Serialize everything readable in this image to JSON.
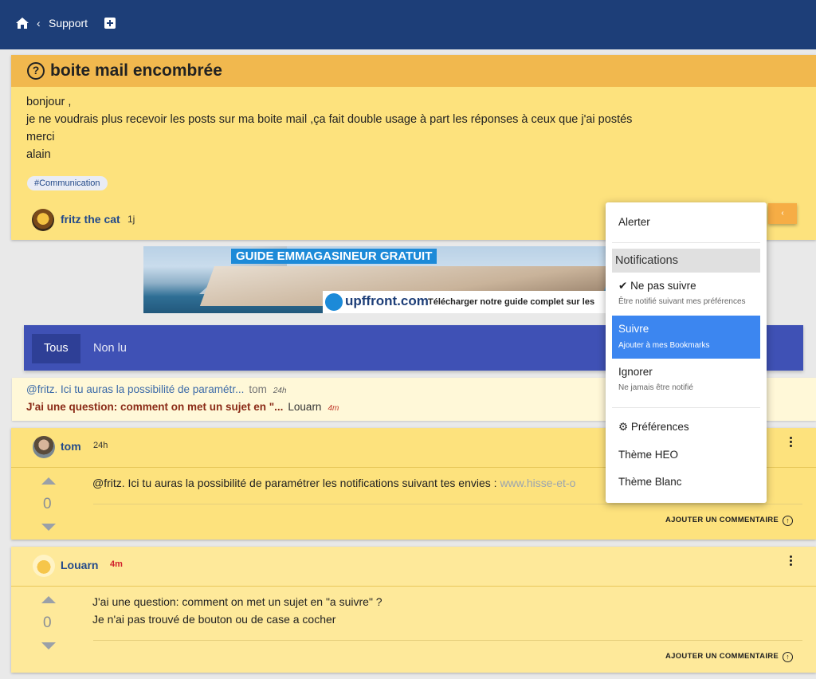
{
  "topbar": {
    "home_icon": "home-icon",
    "back_label": "Support",
    "add_icon": "plus-square-icon",
    "color": "#1d3e78"
  },
  "question": {
    "title": "boite mail encombrée",
    "body": [
      "bonjour ,",
      "je ne voudrais plus recevoir les posts sur ma boite mail ,ça fait double usage à part les réponses à ceux que j'ai postés",
      "merci",
      "alain"
    ],
    "tag": "#Communication",
    "author": "fritz the cat",
    "time": "1j",
    "header_color": "#f1b84e",
    "body_color": "#fde27d"
  },
  "banner": {
    "title": "GUIDE EMMAGASINEUR GRATUIT",
    "logo": "upffront.com",
    "tagline": "Télécharger notre guide complet sur les"
  },
  "tabs": {
    "items": [
      "Tous",
      "Non lu"
    ],
    "active": "Tous"
  },
  "notifications": [
    {
      "text": "@fritz. Ici tu auras la possibilité de paramétr...",
      "author": "tom",
      "time": "24h"
    },
    {
      "text": "J'ai une question: comment on met un sujet en \"...",
      "author": "Louarn",
      "time": "4m"
    }
  ],
  "posts": [
    {
      "author": "tom",
      "time": "24h",
      "votes": "0",
      "lines": [
        "@fritz. Ici tu auras la possibilité de paramétrer les notifications suivant tes envies : "
      ],
      "link": "www.hisse-et-o",
      "comment_label": "AJOUTER UN COMMENTAIRE"
    },
    {
      "author": "Louarn",
      "time": "4m",
      "votes": "0",
      "lines": [
        "J'ai une question: comment on met un sujet en \"a suivre\" ?",
        "Je n'ai pas trouvé de bouton ou de case a cocher"
      ],
      "comment_label": "AJOUTER UN COMMENTAIRE"
    }
  ],
  "dropdown": {
    "alert": "Alerter",
    "section": "Notifications",
    "options": [
      {
        "label": "Ne pas suivre",
        "sub": "Être notifié suivant mes préférences",
        "icon": "check-icon"
      },
      {
        "label": "Suivre",
        "sub": "Ajouter à mes Bookmarks",
        "selected": true
      },
      {
        "label": "Ignorer",
        "sub": "Ne jamais être notifié"
      }
    ],
    "preferences": "Préférences",
    "themes": [
      "Thème HEO",
      "Thème Blanc"
    ],
    "selected_color": "#3c86f0"
  }
}
